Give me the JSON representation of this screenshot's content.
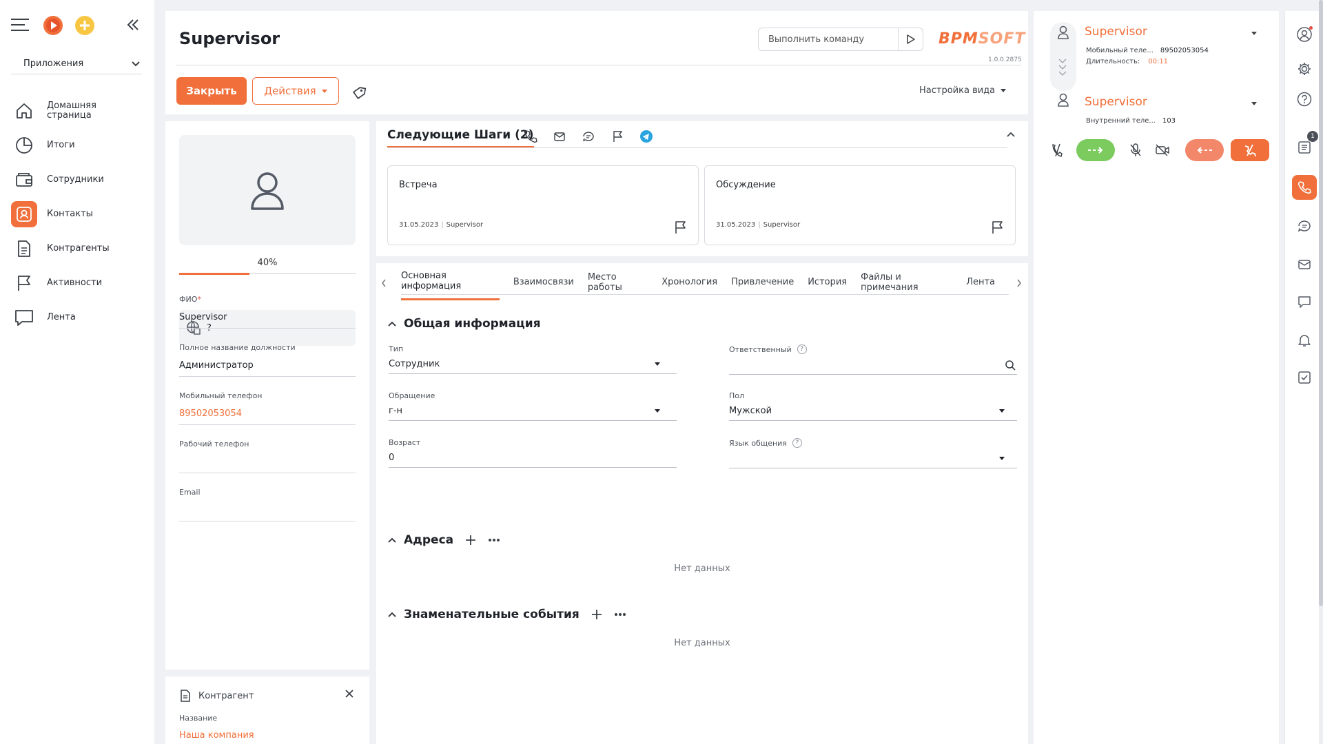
{
  "sidebar": {
    "apps_label": "Приложения",
    "items": [
      {
        "label": "Домашняя страница",
        "icon": "home-icon"
      },
      {
        "label": "Итоги",
        "icon": "pie-chart-icon"
      },
      {
        "label": "Сотрудники",
        "icon": "wallet-icon"
      },
      {
        "label": "Контакты",
        "icon": "contact-icon"
      },
      {
        "label": "Контрагенты",
        "icon": "document-icon"
      },
      {
        "label": "Активности",
        "icon": "flag-icon"
      },
      {
        "label": "Лента",
        "icon": "chat-icon"
      }
    ]
  },
  "header": {
    "title": "Supervisor",
    "command_placeholder": "Выполнить команду",
    "logo_a": "BPM",
    "logo_b": "SOFT",
    "version": "1.0.0.2875",
    "close_label": "Закрыть",
    "actions_label": "Действия",
    "view_settings_label": "Настройка вида"
  },
  "profile": {
    "progress_text": "40%",
    "progress_value": 0.4,
    "web_value": "?",
    "fields": [
      {
        "label": "ФИО",
        "required_mark": "*",
        "value": "Supervisor"
      },
      {
        "label": "Полное название должности",
        "value": "Администратор"
      },
      {
        "label": "Мобильный телефон",
        "value": "89502053054"
      },
      {
        "label": "Рабочий телефон",
        "value": ""
      },
      {
        "label": "Email",
        "value": ""
      }
    ]
  },
  "account_card": {
    "title": "Контрагент",
    "name_label": "Название",
    "name_value": "Наша компания"
  },
  "next_steps": {
    "title": "Следующие Шаги (2)",
    "cards": [
      {
        "title": "Встреча",
        "date": "31.05.2023",
        "owner": "Supervisor"
      },
      {
        "title": "Обсуждение",
        "date": "31.05.2023",
        "owner": "Supervisor"
      }
    ]
  },
  "tabs": [
    "Основная информация",
    "Взаимосвязи",
    "Место работы",
    "Хронология",
    "Привлечение",
    "История",
    "Файлы и примечания",
    "Лента"
  ],
  "general": {
    "title": "Общая информация",
    "type_label": "Тип",
    "type_value": "Сотрудник",
    "owner_label": "Ответственный",
    "owner_value": "",
    "salutation_label": "Обращение",
    "salutation_value": "г-н",
    "gender_label": "Пол",
    "gender_value": "Мужской",
    "age_label": "Возраст",
    "age_value": "0",
    "language_label": "Язык общения",
    "language_value": ""
  },
  "addresses": {
    "title": "Адреса",
    "empty": "Нет данных"
  },
  "events": {
    "title": "Знаменательные события",
    "empty": "Нет данных"
  },
  "calls": [
    {
      "name": "Supervisor",
      "line1_label": "Мобильный теле...",
      "line1_value": "89502053054",
      "line2_label": "Длительность:",
      "line2_value": "00:11"
    },
    {
      "name": "Supervisor",
      "line1_label": "Внутренний теле...",
      "line1_value": "103"
    }
  ],
  "right_rail": {
    "badge": "1"
  },
  "colors": {
    "accent": "#f06f3a",
    "green": "#7ccb5f",
    "decline": "#f2876a"
  }
}
